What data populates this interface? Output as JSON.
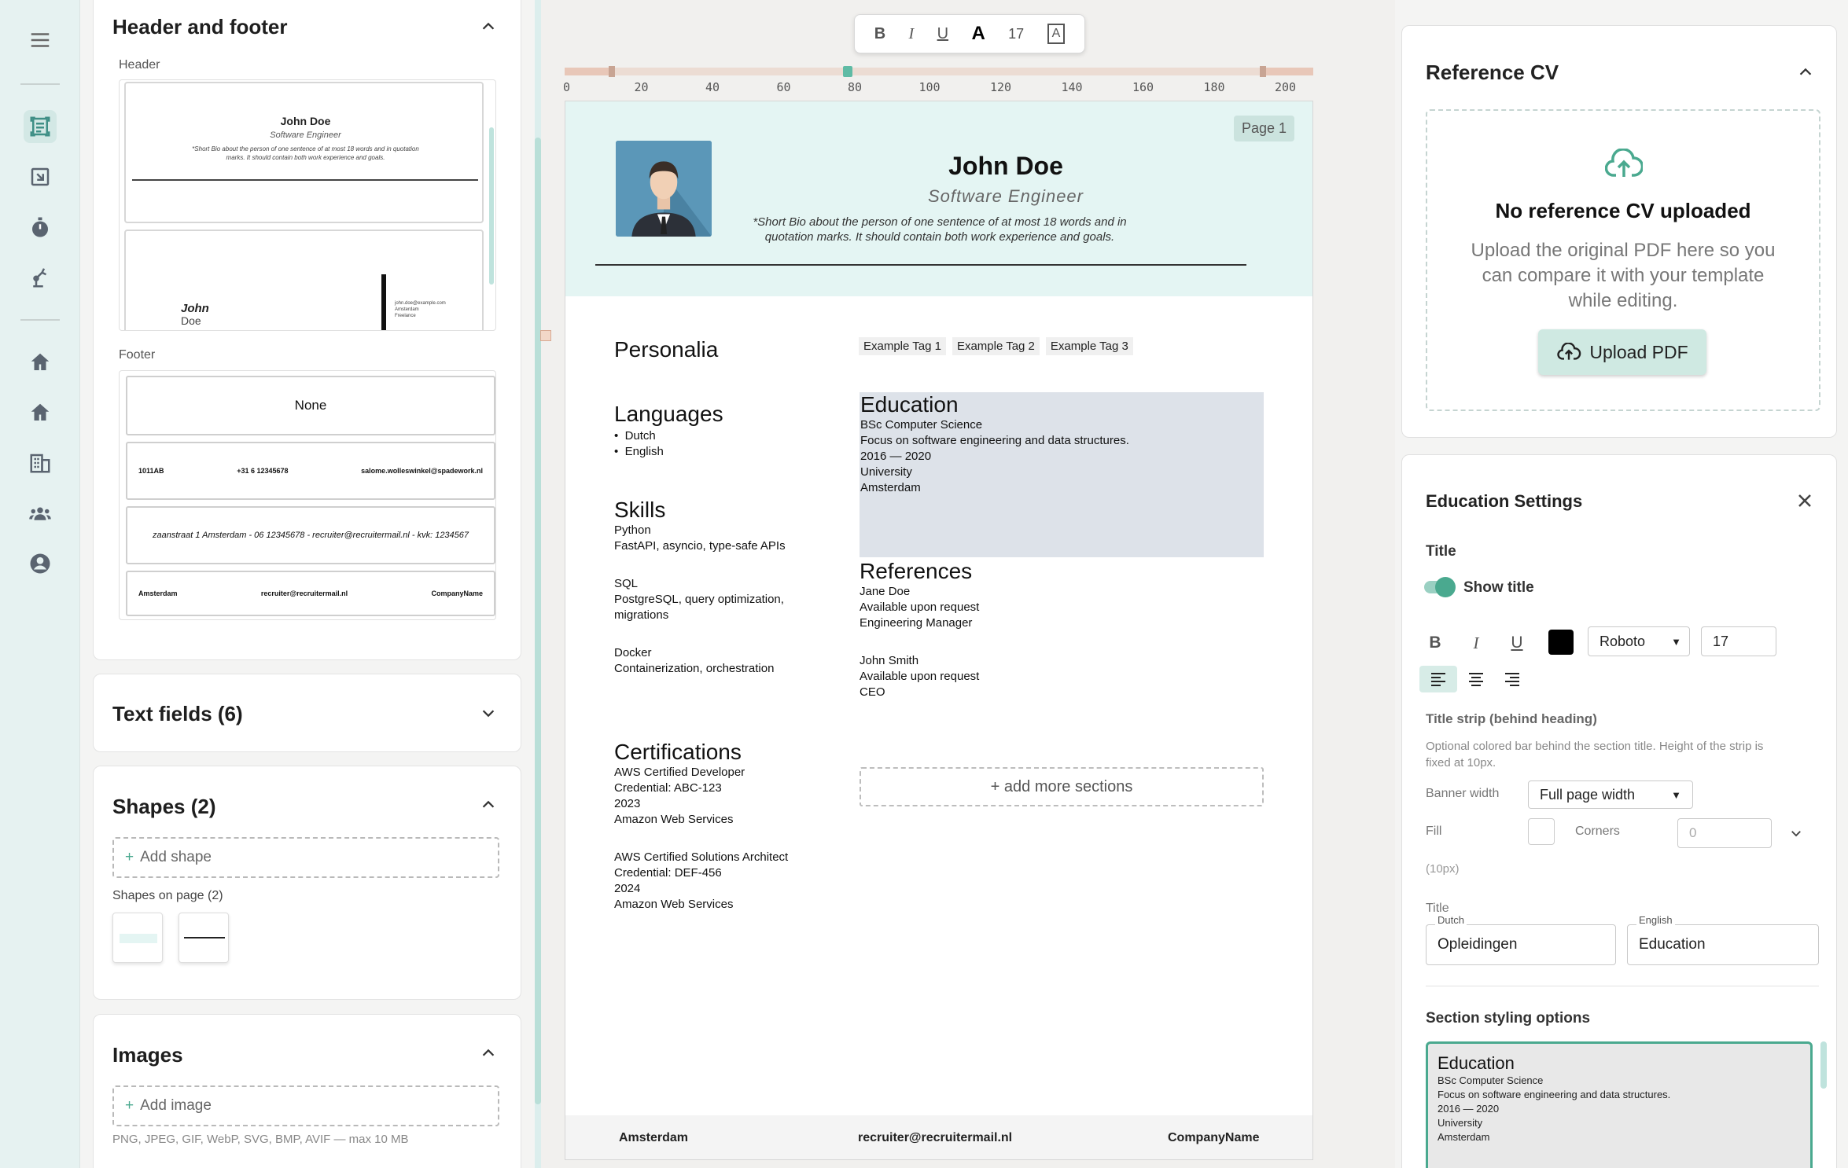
{
  "header_footer": {
    "title": "Header and footer",
    "header_label": "Header",
    "footer_label": "Footer",
    "thumb1": {
      "name": "John Doe",
      "role": "Software Engineer",
      "bio": "*Short Bio about the person of one sentence of at most 18 words and in quotation marks. It should contain both work experience and goals."
    },
    "thumb2": {
      "first": "John",
      "last": "Doe",
      "email": "john.doe@example.com",
      "city": "Amsterdam",
      "status": "Freelance"
    },
    "footers": {
      "none": "None",
      "row2": [
        "1011AB",
        "+31 6 12345678",
        "salome.wolleswinkel@spadework.nl"
      ],
      "row3": "zaanstraat 1 Amsterdam - 06 12345678 - recruiter@recruitermail.nl - kvk: 1234567",
      "row4": [
        "Amsterdam",
        "recruiter@recruitermail.nl",
        "CompanyName"
      ]
    }
  },
  "text_fields": {
    "title": "Text fields (6)"
  },
  "shapes": {
    "title": "Shapes (2)",
    "add": "Add shape",
    "on_page": "Shapes on page (2)"
  },
  "images": {
    "title": "Images",
    "add": "Add image",
    "hint": "PNG, JPEG, GIF, WebP, SVG, BMP, AVIF — max 10 MB"
  },
  "toolbar": {
    "bold": "B",
    "italic": "I",
    "underline": "U",
    "font": "A",
    "size": "17"
  },
  "ruler": {
    "ticks": [
      "0",
      "20",
      "40",
      "60",
      "80",
      "100",
      "120",
      "140",
      "160",
      "180",
      "200"
    ]
  },
  "page": {
    "badge": "Page 1",
    "name": "John Doe",
    "role": "Software Engineer",
    "bio_line1": "*Short Bio about the person of one sentence of at most 18 words and in",
    "bio_line2": "quotation marks. It should contain both work experience and goals.",
    "personalia": "Personalia",
    "tags": [
      "Example Tag 1",
      "Example Tag 2",
      "Example Tag 3"
    ],
    "languages": {
      "title": "Languages",
      "items": [
        "Dutch",
        "English"
      ]
    },
    "skills": {
      "title": "Skills",
      "items": [
        {
          "name": "Python",
          "desc": "FastAPI, asyncio, type-safe APIs"
        },
        {
          "name": "SQL",
          "desc1": "PostgreSQL, query optimization,",
          "desc2": "migrations"
        },
        {
          "name": "Docker",
          "desc": "Containerization, orchestration"
        }
      ]
    },
    "certifications": {
      "title": "Certifications",
      "items": [
        {
          "name": "AWS Certified Developer",
          "cred": "Credential: ABC-123",
          "year": "2023",
          "org": "Amazon Web Services"
        },
        {
          "name": "AWS Certified Solutions Architect",
          "cred": "Credential: DEF-456",
          "year": "2024",
          "org": "Amazon Web Services"
        }
      ]
    },
    "education": {
      "title": "Education",
      "degree": "BSc Computer Science",
      "desc": "Focus on software engineering and data structures.",
      "years": "2016 — 2020",
      "type": "University",
      "city": "Amsterdam"
    },
    "references": {
      "title": "References",
      "items": [
        {
          "name": "Jane Doe",
          "avail": "Available upon request",
          "role": "Engineering Manager"
        },
        {
          "name": "John Smith",
          "avail": "Available upon request",
          "role": "CEO"
        }
      ]
    },
    "add_sections": "+ add more sections",
    "footer": [
      "Amsterdam",
      "recruiter@recruitermail.nl",
      "CompanyName"
    ]
  },
  "reference_cv": {
    "title": "Reference CV",
    "empty_title": "No reference CV uploaded",
    "empty_line1": "Upload the original PDF here so you",
    "empty_line2": "can compare it with your template",
    "empty_line3": "while editing.",
    "upload": "Upload PDF"
  },
  "settings": {
    "title": "Education Settings",
    "title_section": "Title",
    "show_title": "Show title",
    "font": "Roboto",
    "size": "17",
    "strip_title": "Title strip (behind heading)",
    "strip_desc1": "Optional colored bar behind the section title. Height of the strip is",
    "strip_desc2": "fixed at 10px.",
    "banner_label": "Banner width",
    "banner_value": "Full page width",
    "fill_label": "Fill",
    "corners_label": "Corners",
    "corners_value": "0",
    "px_hint": "(10px)",
    "title_label": "Title",
    "dutch_label": "Dutch",
    "dutch_value": "Opleidingen",
    "english_label": "English",
    "english_value": "Education",
    "styling_title": "Section styling options",
    "preview": {
      "title": "Education",
      "degree": "BSc Computer Science",
      "desc": "Focus on software engineering and data structures.",
      "years": "2016 — 2020",
      "type": "University",
      "city": "Amsterdam"
    }
  },
  "colors": {
    "accent": "#4aa98f",
    "header_bg": "#e4f5f3",
    "highlight": "#dde2e9"
  }
}
